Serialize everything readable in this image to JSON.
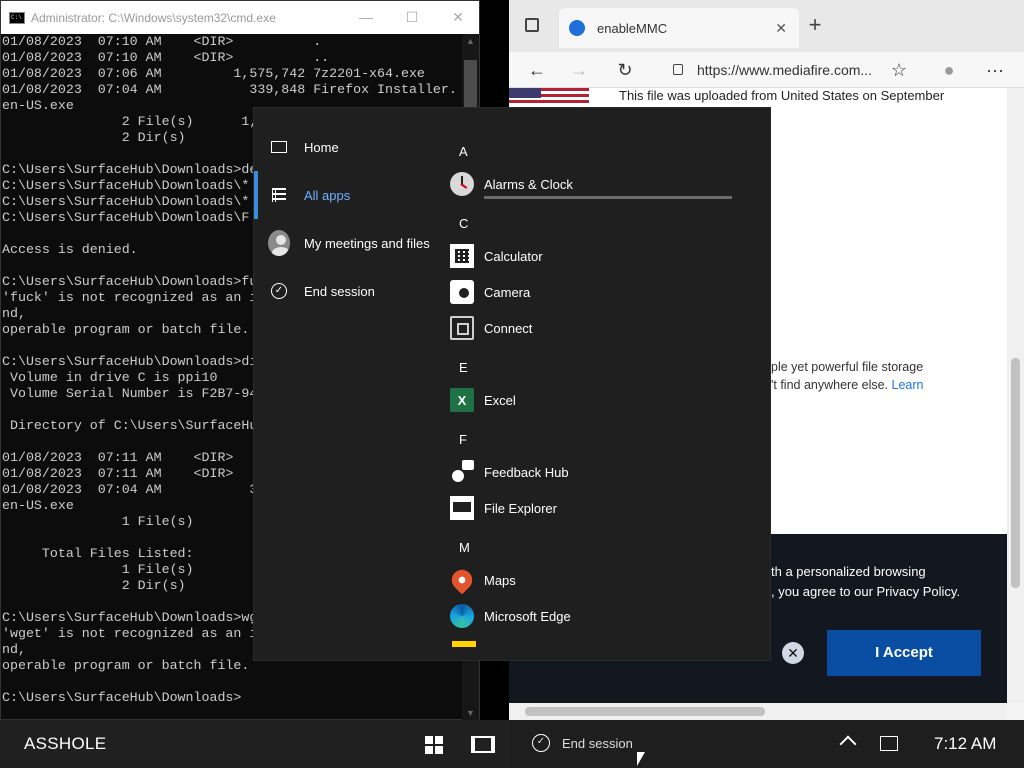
{
  "cmd": {
    "title": "Administrator: C:\\Windows\\system32\\cmd.exe",
    "minimize": "—",
    "maximize": "☐",
    "close": "✕",
    "lines": [
      "01/08/2023  07:10 AM    <DIR>          .",
      "01/08/2023  07:10 AM    <DIR>          ..",
      "01/08/2023  07:06 AM         1,575,742 7z2201-x64.exe",
      "01/08/2023  07:04 AM           339,848 Firefox Installer.",
      "en-US.exe",
      "               2 File(s)      1,",
      "               2 Dir(s)",
      "",
      "C:\\Users\\SurfaceHub\\Downloads>de",
      "C:\\Users\\SurfaceHub\\Downloads\\*",
      "C:\\Users\\SurfaceHub\\Downloads\\*",
      "C:\\Users\\SurfaceHub\\Downloads\\F",
      "",
      "Access is denied.",
      "",
      "C:\\Users\\SurfaceHub\\Downloads>fu",
      "'fuck' is not recognized as an i",
      "nd,",
      "operable program or batch file.",
      "",
      "C:\\Users\\SurfaceHub\\Downloads>di",
      " Volume in drive C is ppi10",
      " Volume Serial Number is F2B7-94",
      "",
      " Directory of C:\\Users\\SurfaceHu",
      "",
      "01/08/2023  07:11 AM    <DIR>",
      "01/08/2023  07:11 AM    <DIR>",
      "01/08/2023  07:04 AM           3",
      "en-US.exe",
      "               1 File(s)",
      "",
      "     Total Files Listed:",
      "               1 File(s)",
      "               2 Dir(s)",
      "",
      "C:\\Users\\SurfaceHub\\Downloads>wg",
      "'wget' is not recognized as an i",
      "nd,",
      "operable program or batch file.",
      "",
      "C:\\Users\\SurfaceHub\\Downloads>"
    ]
  },
  "edge": {
    "tab_title": "enableMMC",
    "tab_close": "✕",
    "new_tab": "+",
    "back": "←",
    "forward": "→",
    "refresh": "↻",
    "url": "https://www.mediafire.com...",
    "favorite": "☆",
    "more": "···",
    "upload_note": "This file was uploaded from United States on September",
    "desc_line1": "ple yet powerful file storage",
    "desc_line2": "'t find anywhere else.",
    "learn": "Learn",
    "cookie_line1": "th a personalized browsing",
    "cookie_line2": ", you agree to our Privacy Policy.",
    "cookie_close": "✕",
    "accept_label": "I Accept"
  },
  "start_menu": {
    "nav": [
      {
        "label": "Home",
        "icon": "home-icon"
      },
      {
        "label": "All apps",
        "icon": "all-apps-icon",
        "active": true
      },
      {
        "label": "My meetings and files",
        "icon": "user-icon"
      },
      {
        "label": "End session",
        "icon": "check-circle-icon"
      }
    ],
    "letters": [
      "A",
      "C",
      "E",
      "F",
      "M"
    ],
    "apps": [
      {
        "label": "Alarms & Clock",
        "icon": "alarms-clock-icon"
      },
      {
        "label": "Calculator",
        "icon": "calculator-icon"
      },
      {
        "label": "Camera",
        "icon": "camera-icon"
      },
      {
        "label": "Connect",
        "icon": "connect-icon"
      },
      {
        "label": "Excel",
        "icon": "excel-icon",
        "icon_text": "X"
      },
      {
        "label": "Feedback Hub",
        "icon": "feedback-hub-icon"
      },
      {
        "label": "File Explorer",
        "icon": "file-explorer-icon"
      },
      {
        "label": "Maps",
        "icon": "maps-icon"
      },
      {
        "label": "Microsoft Edge",
        "icon": "edge-icon"
      }
    ]
  },
  "taskbar": {
    "device_name": "ASSHOLE",
    "end_session": "End session",
    "time": "7:12 AM"
  },
  "colors": {
    "accent": "#3a8dde",
    "accept_button": "#0a4ea4",
    "excel": "#1e7145"
  }
}
